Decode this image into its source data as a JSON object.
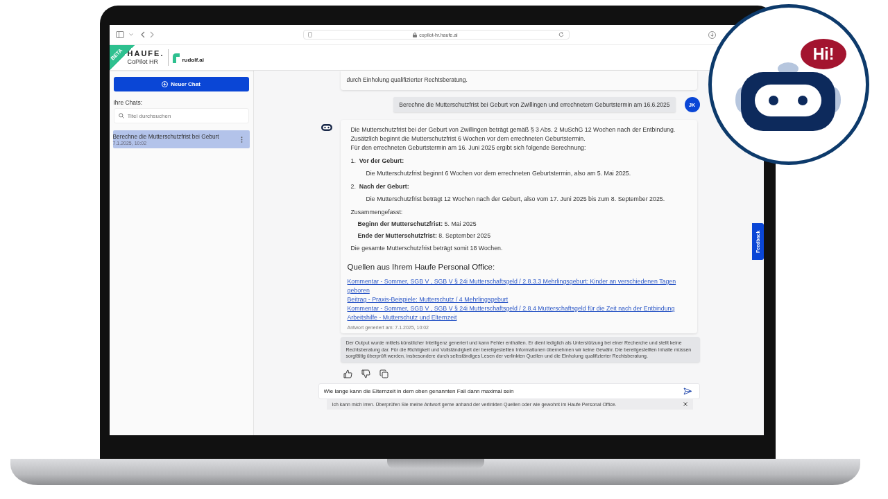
{
  "browser": {
    "url": "copilot-hr.haufe.ai"
  },
  "header": {
    "beta_badge": "BETA",
    "brand": "HAUFE.",
    "product": "CoPilot HR",
    "partner": "rudolf.ai"
  },
  "sidebar": {
    "new_chat_button": "Neuer Chat",
    "chats_heading": "Ihre Chats:",
    "search_placeholder": "Titel durchsuchen",
    "chats": [
      {
        "title": "Berechne die Mutterschutzfrist bei Geburt",
        "date": "7.1.2025, 10:02",
        "selected": true
      }
    ]
  },
  "chat": {
    "previous_message_tail": "durch Einholung qualifizierter Rechtsberatung.",
    "user_message": {
      "text": "Berechne die Mutterschutzfrist bei Geburt von Zwillingen und errechnetem Geburtstermin am 16.6.2025",
      "avatar": "JK"
    },
    "answer": {
      "intro": [
        "Die Mutterschutzfrist bei der Geburt von Zwillingen beträgt gemäß § 3 Abs. 2 MuSchG 12 Wochen nach der Entbindung.",
        "Zusätzlich beginnt die Mutterschutzfrist 6 Wochen vor dem errechneten Geburtstermin.",
        "Für den errechneten Geburtstermin am 16. Juni 2025 ergibt sich folgende Berechnung:"
      ],
      "steps": [
        {
          "number": "1.",
          "title": "Vor der Geburt:",
          "detail": "Die Mutterschutzfrist beginnt 6 Wochen vor dem errechneten Geburtstermin, also am 5. Mai 2025."
        },
        {
          "number": "2.",
          "title": "Nach der Geburt:",
          "detail": "Die Mutterschutzfrist beträgt 12 Wochen nach der Geburt, also vom 17. Juni 2025 bis zum 8. September 2025."
        }
      ],
      "summary_label": "Zusammengefasst:",
      "summary": [
        "**Beginn der Mutterschutzfrist:** 5. Mai 2025",
        "**Ende der Mutterschutzfrist:** 8. September 2025"
      ],
      "conclusion": "Die gesamte Mutterschutzfrist beträgt somit 18 Wochen.",
      "sources_heading": "Quellen aus Ihrem Haufe Personal Office:",
      "sources": [
        "Kommentar - Sommer, SGB V , SGB V § 24i Mutterschaftsgeld / 2.8.3.3 Mehrlingsgeburt: Kinder an verschiedenen Tagen geboren",
        "Beitrag - Praxis-Beispiele: Mutterschutz / 4 Mehrlingsgeburt",
        "Kommentar - Sommer, SGB V , SGB V § 24i Mutterschaftsgeld / 2.8.4 Mutterschaftsgeld für die Zeit nach der Entbindung",
        "Arbeitshilfe - Mutterschutz und Elternzeit"
      ],
      "generated": "Antwort generiert am: 7.1.2025, 10:02"
    },
    "disclaimer": "Der Output wurde mittels künstlicher Intelligenz generiert und kann Fehler enthalten. Er dient lediglich als Unterstützung bei einer Recherche und stellt keine Rechtsberatung dar. Für die Richtigkeit und Vollständigkeit der bereitgestellten Informationen übernehmen wir keine Gewähr. Die bereitgestellten Inhalte müssen sorgfältig überprüft werden, insbesondere durch selbständiges Lesen der verlinkten Quellen und die Einholung qualifizierter Rechtsberatung.",
    "input": {
      "value": "Wie lange kann die Elternzeit in dem oben genannten Fall dann maximal sein"
    },
    "hint": "Ich kann mich irren. Überprüfen Sie meine Antwort gerne anhand der verlinkten Quellen oder wie gewohnt im Haufe Personal Office."
  },
  "feedback_tab": "Feedback",
  "badge": {
    "text": "Hi!"
  }
}
